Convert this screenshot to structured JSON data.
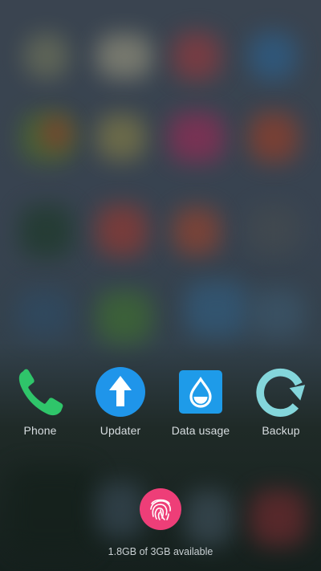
{
  "dock": {
    "apps": [
      {
        "label": "Phone",
        "icon": "phone-icon",
        "color": "#2ecc71"
      },
      {
        "label": "Updater",
        "icon": "arrow-up-icon",
        "color": "#2196f3"
      },
      {
        "label": "Data usage",
        "icon": "water-drop-icon",
        "color": "#1e9be9"
      },
      {
        "label": "Backup",
        "icon": "refresh-icon",
        "color": "#7fd3d8"
      }
    ]
  },
  "fingerprint": {
    "icon": "fingerprint-icon",
    "color": "#ee3e78"
  },
  "memory": {
    "text": "1.8GB of 3GB available"
  }
}
